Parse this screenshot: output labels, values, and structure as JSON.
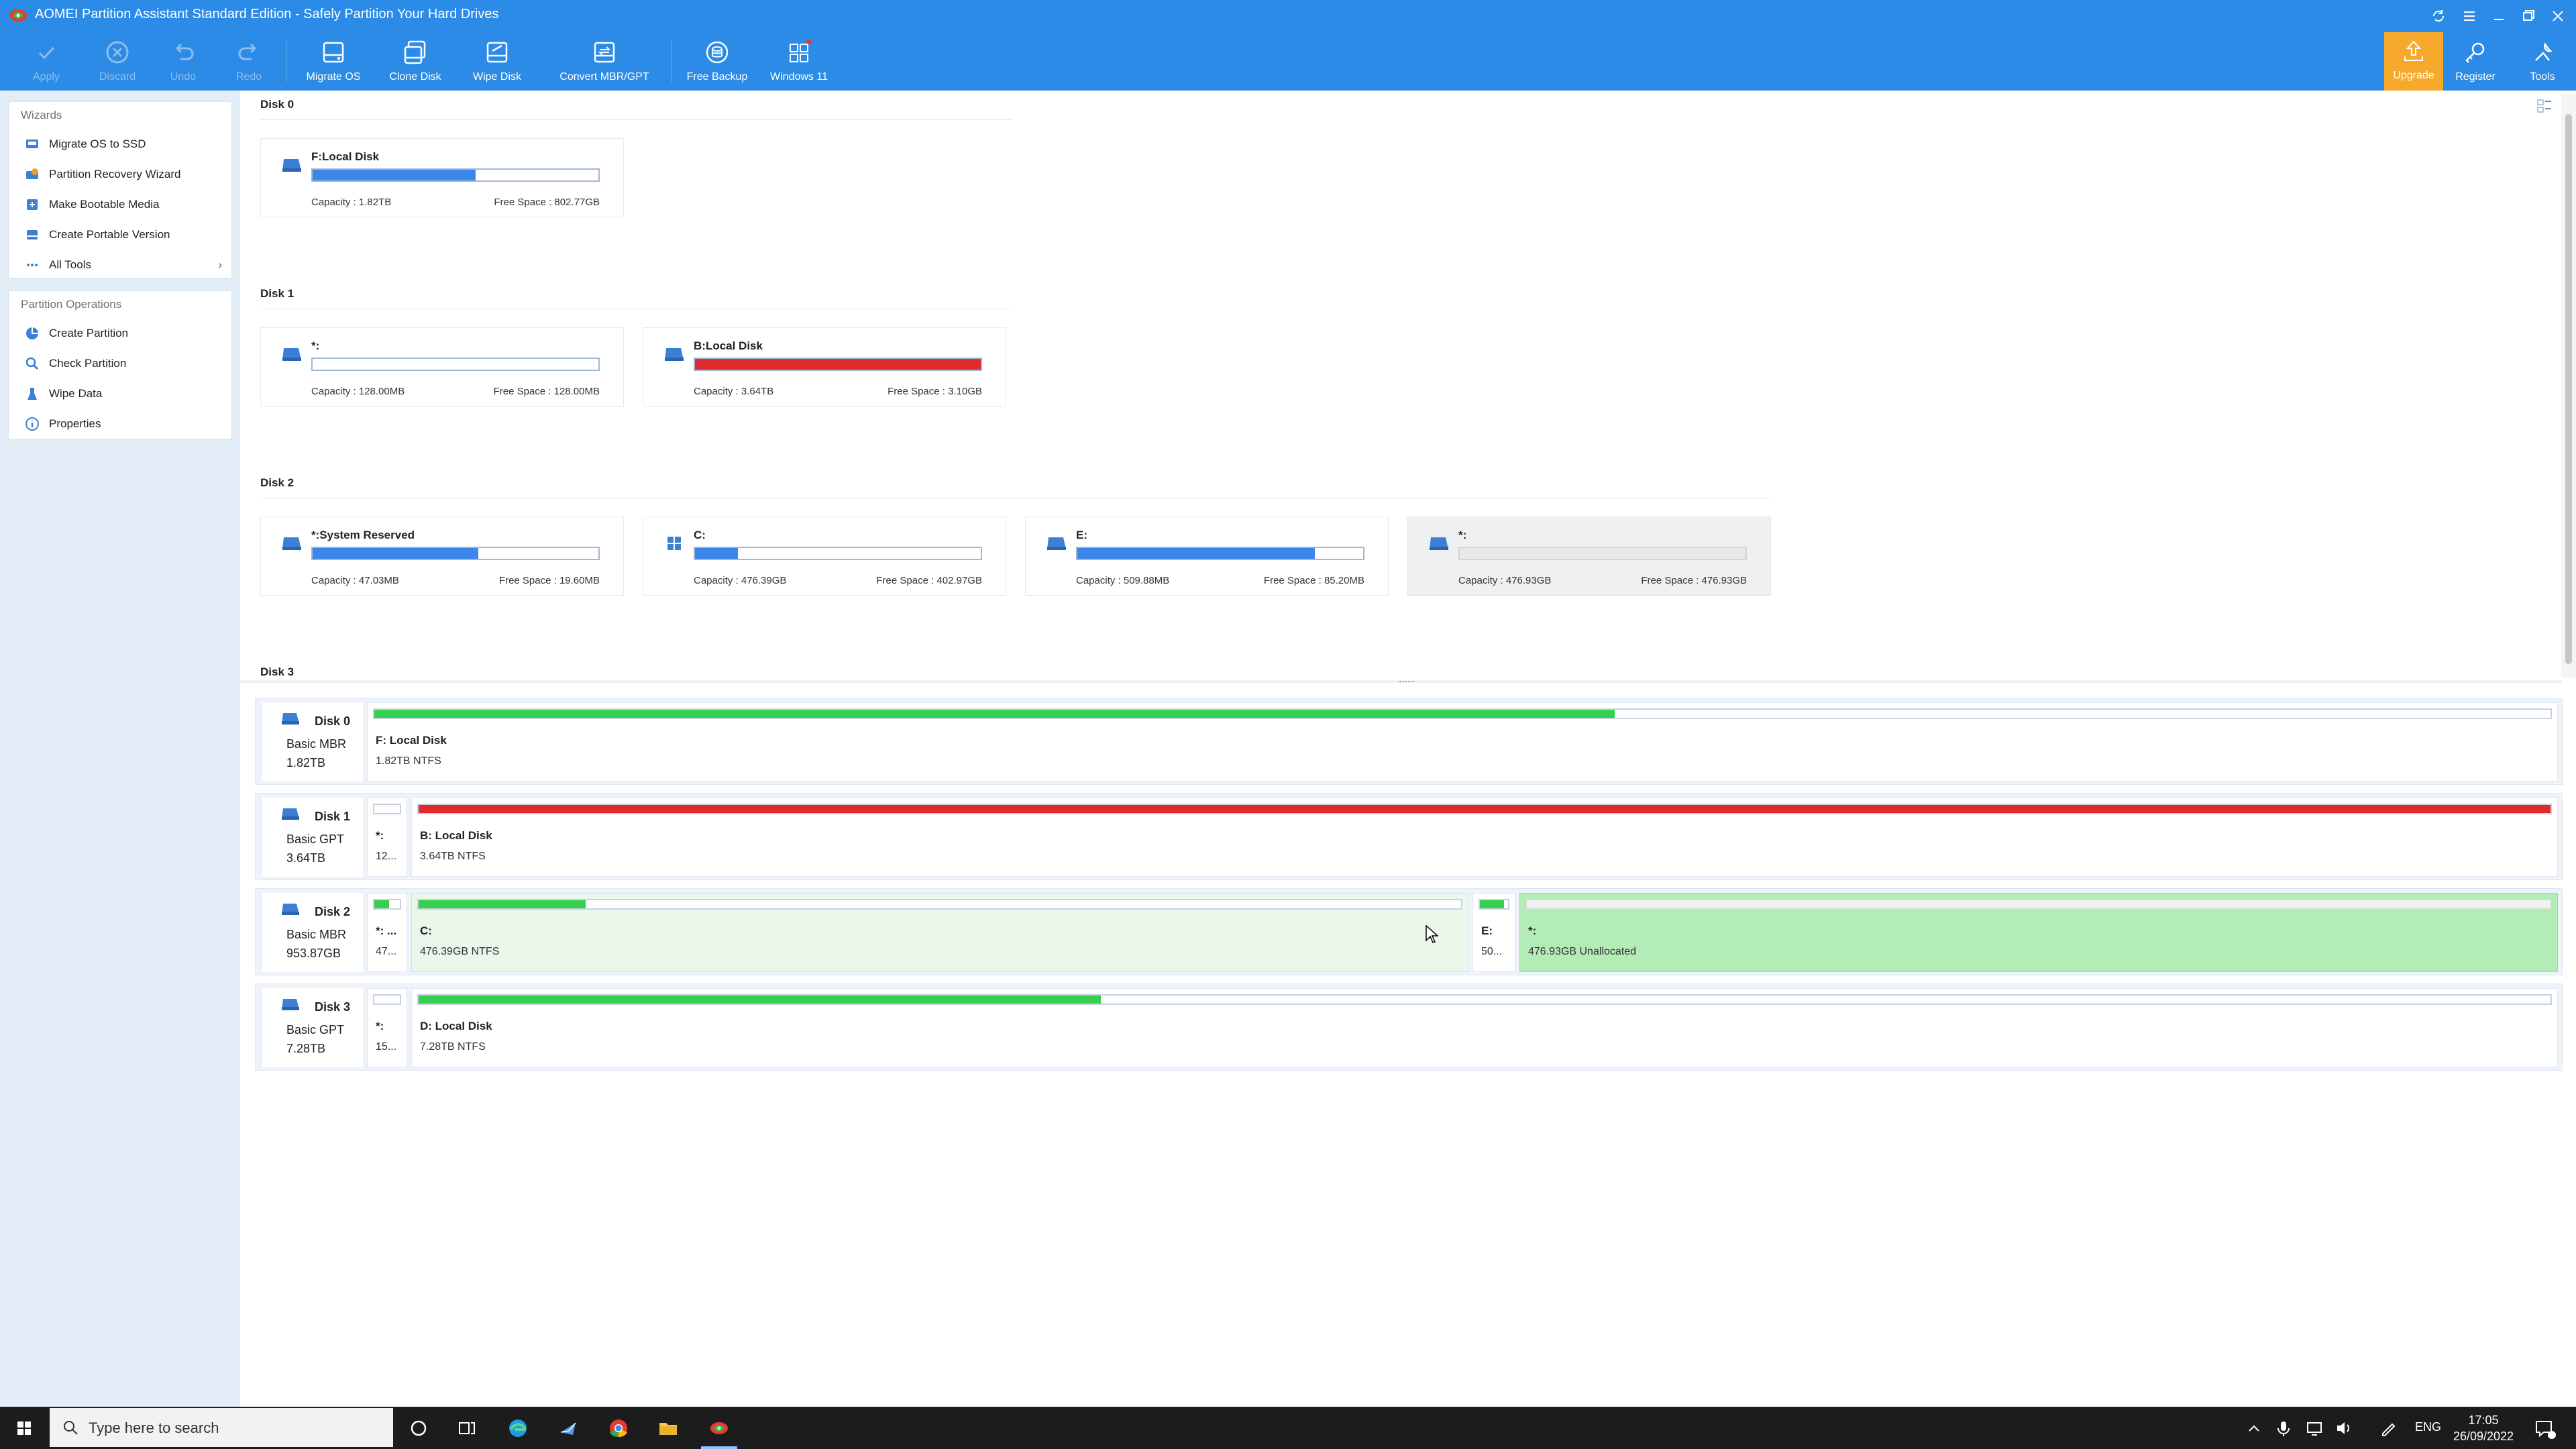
{
  "window": {
    "title": "AOMEI Partition Assistant Standard Edition - Safely Partition Your Hard Drives"
  },
  "toolbar": {
    "apply": "Apply",
    "discard": "Discard",
    "undo": "Undo",
    "redo": "Redo",
    "migrate_os": "Migrate OS",
    "clone_disk": "Clone Disk",
    "wipe_disk": "Wipe Disk",
    "convert": "Convert MBR/GPT",
    "free_backup": "Free Backup",
    "windows11": "Windows 11",
    "upgrade": "Upgrade",
    "register": "Register",
    "tools": "Tools"
  },
  "sidebar": {
    "wizards_title": "Wizards",
    "wizards": [
      {
        "label": "Migrate OS to SSD",
        "icon": "migrate-icon"
      },
      {
        "label": "Partition Recovery Wizard",
        "icon": "recovery-icon"
      },
      {
        "label": "Make Bootable Media",
        "icon": "bootable-media-icon"
      },
      {
        "label": "Create Portable Version",
        "icon": "portable-icon"
      },
      {
        "label": "All Tools",
        "icon": "more-icon"
      }
    ],
    "ops_title": "Partition Operations",
    "ops": [
      {
        "label": "Create Partition",
        "icon": "create-partition-icon"
      },
      {
        "label": "Check Partition",
        "icon": "check-partition-icon"
      },
      {
        "label": "Wipe Data",
        "icon": "wipe-data-icon"
      },
      {
        "label": "Properties",
        "icon": "info-icon"
      }
    ]
  },
  "cards_view": {
    "disk0": {
      "label": "Disk 0",
      "partitions": [
        {
          "name": "F:Local Disk",
          "capacity": "Capacity : 1.82TB",
          "free": "Free Space : 802.77GB",
          "used_fraction": 0.57,
          "color": "#3d86ea"
        }
      ]
    },
    "disk1": {
      "label": "Disk 1",
      "partitions": [
        {
          "name": "*:",
          "capacity": "Capacity : 128.00MB",
          "free": "Free Space : 128.00MB",
          "used_fraction": 0.0,
          "color": "#3d86ea"
        },
        {
          "name": "B:Local Disk",
          "capacity": "Capacity : 3.64TB",
          "free": "Free Space : 3.10GB",
          "used_fraction": 1.0,
          "color": "#e02b2b"
        }
      ]
    },
    "disk2": {
      "label": "Disk 2",
      "partitions": [
        {
          "name": "*:System Reserved",
          "capacity": "Capacity : 47.03MB",
          "free": "Free Space : 19.60MB",
          "used_fraction": 0.58,
          "color": "#3d86ea"
        },
        {
          "name": "C:",
          "capacity": "Capacity : 476.39GB",
          "free": "Free Space : 402.97GB",
          "used_fraction": 0.15,
          "color": "#3d86ea"
        },
        {
          "name": "E:",
          "capacity": "Capacity : 509.88MB",
          "free": "Free Space : 85.20MB",
          "used_fraction": 0.83,
          "color": "#3d86ea"
        },
        {
          "name": "*:",
          "capacity": "Capacity : 476.93GB",
          "free": "Free Space : 476.93GB",
          "used_fraction": 0.0,
          "color": "#cfcfcf"
        }
      ]
    },
    "disk3": {
      "label": "Disk 3"
    }
  },
  "disk_rows": [
    {
      "name": "Disk 0",
      "type": "Basic MBR",
      "size": "1.82TB",
      "segments": [
        {
          "name": "F: Local Disk",
          "detail": "1.82TB NTFS",
          "used_fraction": 0.57,
          "color": "#35d04e"
        }
      ]
    },
    {
      "name": "Disk 1",
      "type": "Basic GPT",
      "size": "3.64TB",
      "segments": [
        {
          "name": "*:",
          "detail": "12...",
          "used_fraction": 0.0,
          "color": "#35d04e"
        },
        {
          "name": "B: Local Disk",
          "detail": "3.64TB NTFS",
          "used_fraction": 1.0,
          "color": "#e02b2b"
        }
      ]
    },
    {
      "name": "Disk 2",
      "type": "Basic MBR",
      "size": "953.87GB",
      "segments": [
        {
          "name": "*: ...",
          "detail": "47...",
          "used_fraction": 0.58,
          "color": "#35d04e"
        },
        {
          "name": "C:",
          "detail": "476.39GB NTFS",
          "used_fraction": 0.16,
          "color": "#35d04e"
        },
        {
          "name": "E:",
          "detail": "50...",
          "used_fraction": 0.85,
          "color": "#35d04e"
        },
        {
          "name": "*:",
          "detail": "476.93GB Unallocated",
          "used_fraction": 0.0,
          "color": "#35d04e"
        }
      ]
    },
    {
      "name": "Disk 3",
      "type": "Basic GPT",
      "size": "7.28TB",
      "segments": [
        {
          "name": "*:",
          "detail": "15...",
          "used_fraction": 0.0,
          "color": "#35d04e"
        },
        {
          "name": "D: Local Disk",
          "detail": "7.28TB NTFS",
          "used_fraction": 0.32,
          "color": "#35d04e"
        }
      ]
    }
  ],
  "taskbar": {
    "search_placeholder": "Type here to search",
    "lang": "ENG",
    "time": "17:05",
    "date": "26/09/2022"
  }
}
